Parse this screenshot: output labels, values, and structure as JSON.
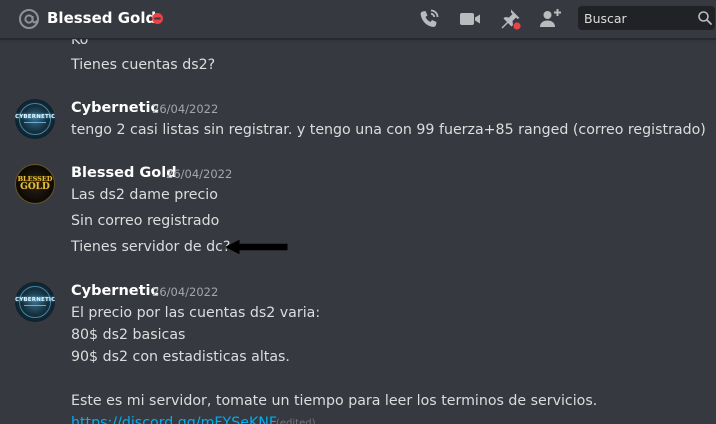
{
  "header": {
    "channel_name": "Blessed Gold",
    "search_placeholder": "Buscar"
  },
  "messages": {
    "truncated_prev_line": "Ko",
    "prev_question": "Tienes cuentas ds2?",
    "groups": [
      {
        "author": "Cybernetic",
        "timestamp": "26/04/2022",
        "avatar_text": "CYBERNETIC",
        "lines": [
          "tengo 2 casi listas sin registrar. y tengo una con 99 fuerza+85 ranged (correo registrado)"
        ]
      },
      {
        "author": "Blessed Gold",
        "timestamp": "26/04/2022",
        "avatar_text": [
          "BLESSED",
          "GOLD"
        ],
        "lines": [
          "Las ds2 dame precio",
          "Sin correo registrado",
          "Tienes servidor de dc?"
        ]
      },
      {
        "author": "Cybernetic",
        "timestamp": "26/04/2022",
        "avatar_text": "CYBERNETIC",
        "lines": [
          "El precio por las cuentas ds2 varia:",
          "80$ ds2 basicas",
          "90$ ds2 con estadisticas altas.",
          "",
          "Este es mi servidor, tomate un tiempo para leer los terminos de servicios."
        ],
        "link": "https://discord.gg/mFYSeKNF",
        "edited": "(edited)"
      }
    ]
  },
  "colors": {
    "background": "#36393f",
    "text": "#dcddde",
    "username": "#ffffff",
    "timestamp": "#a3a6aa",
    "link": "#00aff4",
    "dnd_status": "#ed4245",
    "search_bg": "#202225",
    "icon": "#b9bbbe"
  }
}
